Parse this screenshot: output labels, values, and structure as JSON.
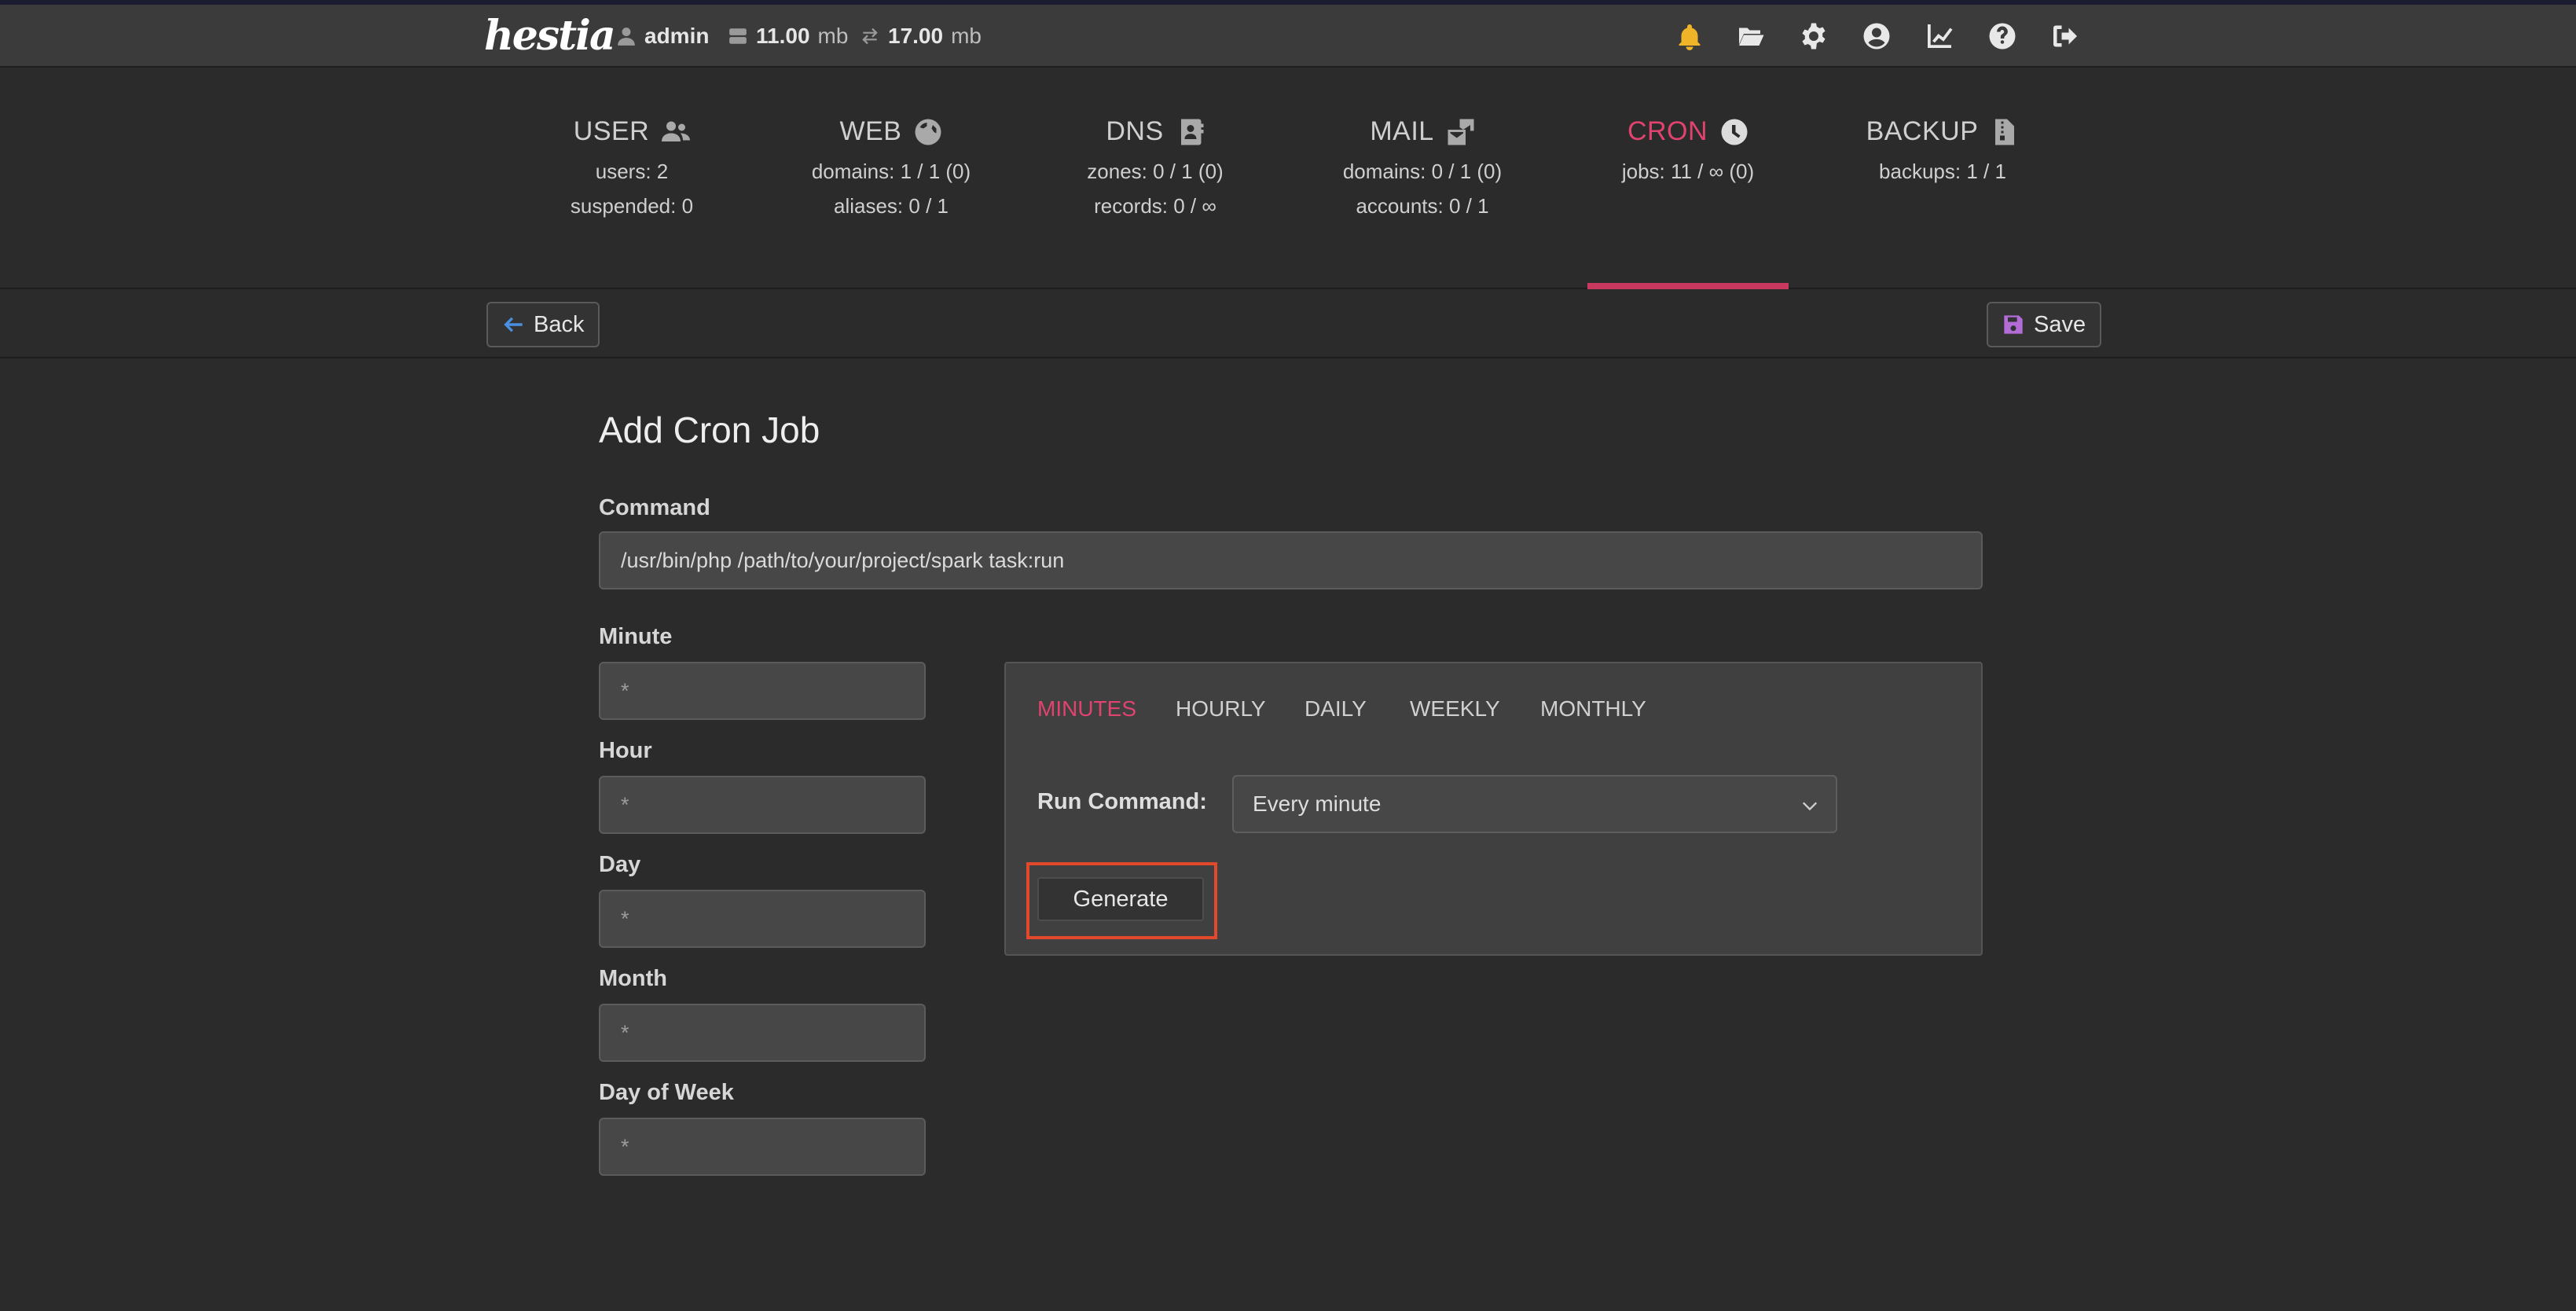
{
  "topbar": {
    "logo_text": "hestia",
    "user": "admin",
    "disk_value": "11.00",
    "disk_unit": "mb",
    "bandwidth_value": "17.00",
    "bandwidth_unit": "mb",
    "icons": [
      "bell-icon",
      "folder-open-icon",
      "gear-icon",
      "user-circle-icon",
      "chart-line-icon",
      "question-icon",
      "logout-icon"
    ],
    "accent_colors": {
      "bell": "#f0b429",
      "active": "#e0436f",
      "save_icon": "#b36bd6",
      "back_icon": "#4a90e2",
      "highlight": "#e2492c"
    }
  },
  "stats": [
    {
      "key": "user",
      "title": "USER",
      "icon": "users-icon",
      "lines": [
        "users: 2",
        "suspended: 0"
      ]
    },
    {
      "key": "web",
      "title": "WEB",
      "icon": "globe-icon",
      "lines": [
        "domains: 1 / 1 (0)",
        "aliases: 0 / 1"
      ]
    },
    {
      "key": "dns",
      "title": "DNS",
      "icon": "address-book-icon",
      "lines": [
        "zones: 0 / 1 (0)",
        "records: 0 / ∞"
      ]
    },
    {
      "key": "mail",
      "title": "MAIL",
      "icon": "mail-bulk-icon",
      "lines": [
        "domains: 0 / 1 (0)",
        "accounts: 0 / 1"
      ]
    },
    {
      "key": "cron",
      "title": "CRON",
      "icon": "clock-icon",
      "lines": [
        "jobs: 11 / ∞ (0)"
      ],
      "active": true
    },
    {
      "key": "backup",
      "title": "BACKUP",
      "icon": "file-archive-icon",
      "lines": [
        "backups: 1 / 1"
      ]
    }
  ],
  "toolbar": {
    "back_label": "Back",
    "save_label": "Save"
  },
  "form": {
    "title": "Add Cron Job",
    "command_label": "Command",
    "command_value": "/usr/bin/php /path/to/your/project/spark task:run",
    "minute_label": "Minute",
    "minute_value": "*",
    "hour_label": "Hour",
    "hour_value": "*",
    "day_label": "Day",
    "day_value": "*",
    "month_label": "Month",
    "month_value": "*",
    "dow_label": "Day of Week",
    "dow_value": "*"
  },
  "generator": {
    "tabs": [
      "MINUTES",
      "HOURLY",
      "DAILY",
      "WEEKLY",
      "MONTHLY"
    ],
    "active_tab": "MINUTES",
    "run_label": "Run Command:",
    "run_value": "Every minute",
    "generate_label": "Generate"
  }
}
